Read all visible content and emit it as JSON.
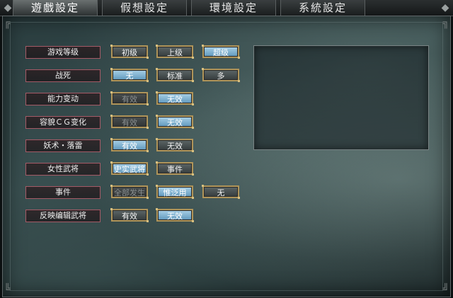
{
  "tabs": [
    {
      "label": "遊戲設定",
      "active": true
    },
    {
      "label": "假想設定",
      "active": false
    },
    {
      "label": "環境設定",
      "active": false
    },
    {
      "label": "系統設定",
      "active": false
    }
  ],
  "settings": [
    {
      "label": "游戏等级",
      "options": [
        {
          "text": "初级",
          "state": "off"
        },
        {
          "text": "上级",
          "state": "off"
        },
        {
          "text": "超级",
          "state": "on"
        }
      ]
    },
    {
      "label": "战死",
      "options": [
        {
          "text": "无",
          "state": "on"
        },
        {
          "text": "标准",
          "state": "off"
        },
        {
          "text": "多",
          "state": "off"
        }
      ]
    },
    {
      "label": "能力变动",
      "options": [
        {
          "text": "有效",
          "state": "disabled"
        },
        {
          "text": "无效",
          "state": "on"
        }
      ]
    },
    {
      "label": "容貌ＣＧ变化",
      "options": [
        {
          "text": "有效",
          "state": "disabled"
        },
        {
          "text": "无效",
          "state": "on"
        }
      ]
    },
    {
      "label": "妖术・落雷",
      "options": [
        {
          "text": "有效",
          "state": "on"
        },
        {
          "text": "无效",
          "state": "off"
        }
      ]
    },
    {
      "label": "女性武将",
      "options": [
        {
          "text": "史实武将",
          "state": "on"
        },
        {
          "text": "事件",
          "state": "off"
        }
      ]
    },
    {
      "label": "事件",
      "options": [
        {
          "text": "全部发生",
          "state": "disabled"
        },
        {
          "text": "惟泛用",
          "state": "on"
        },
        {
          "text": "无",
          "state": "off"
        }
      ]
    },
    {
      "label": "反映编辑武将",
      "options": [
        {
          "text": "有效",
          "state": "off"
        },
        {
          "text": "无效",
          "state": "on"
        }
      ]
    }
  ],
  "colors": {
    "selected": "#7fb3d3",
    "unselected": "#4a5253",
    "disabled": "#3a3f40",
    "button_border": "#b0955a",
    "label_border": "#a55a66"
  }
}
